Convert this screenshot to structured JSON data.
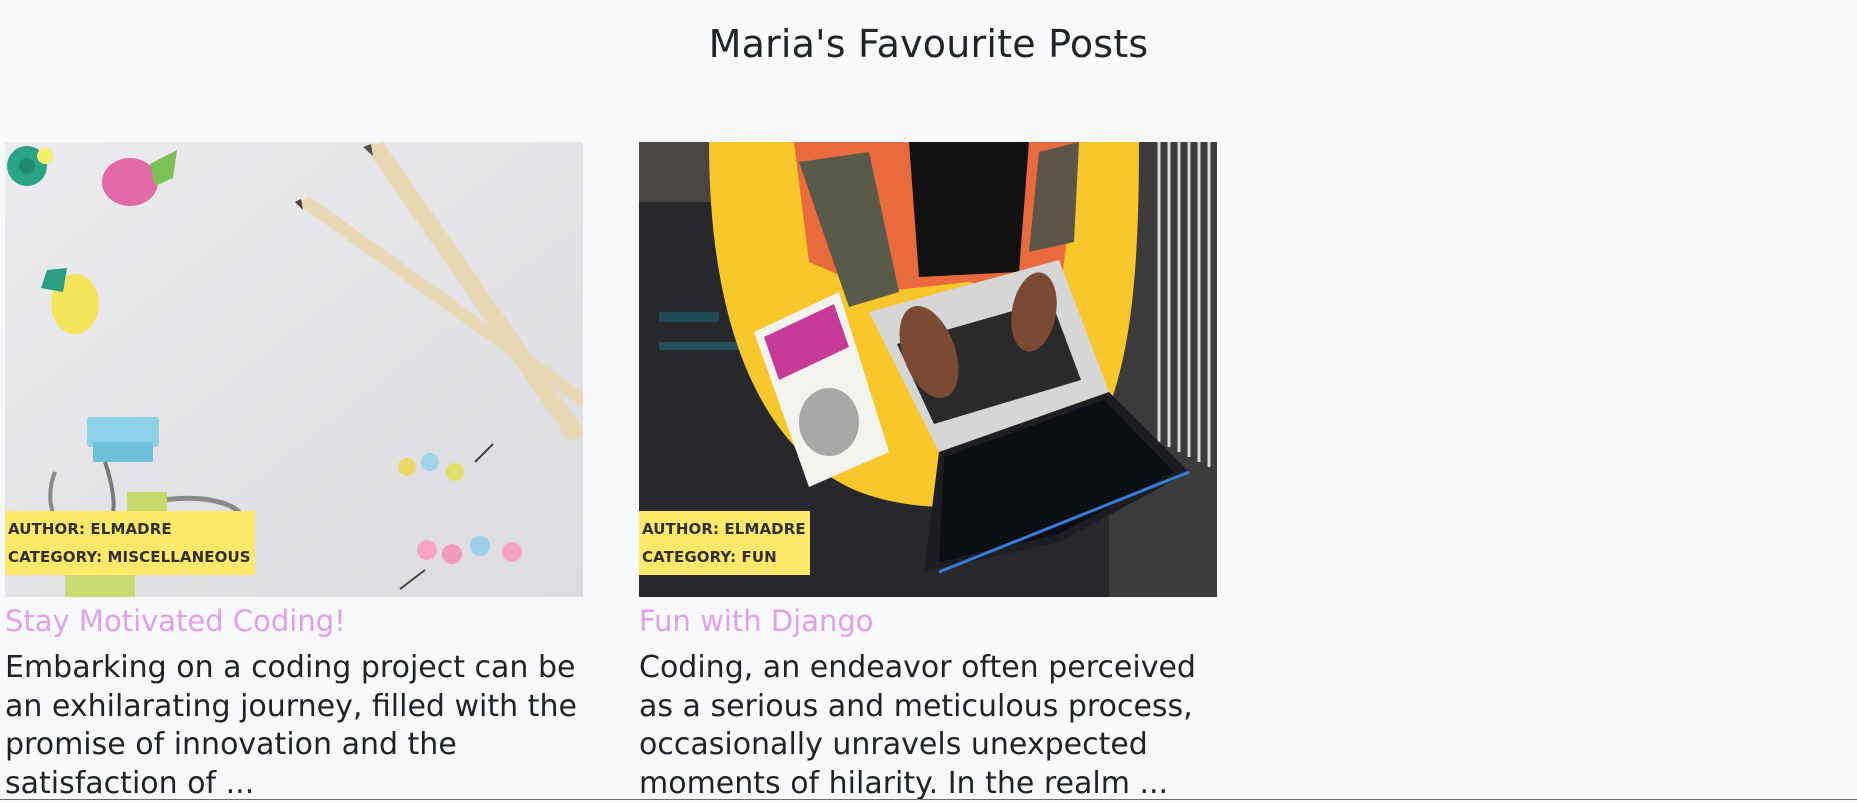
{
  "page": {
    "title": "Maria's Favourite Posts"
  },
  "posts": [
    {
      "title": "Stay Motivated Coding!",
      "author": "AUTHOR: ELMADRE",
      "category": "CATEGORY: MISCELLANEOUS",
      "excerpt": "Embarking on a coding project can be an exhilarating journey, filled with the promise of innovation and the satisfaction of ...",
      "image_alt": "Pencils, pushpins, binder clips and fruit erasers on a white desk"
    },
    {
      "title": "Fun with Django",
      "author": "AUTHOR: ELMADRE",
      "category": "CATEGORY: FUN",
      "excerpt": "Coding, an endeavor often perceived as a serious and meticulous process, occasionally unravels unexpected moments of hilarity. In the realm ...",
      "image_alt": "Person typing on a laptop in a yellow chair with a Python book"
    }
  ],
  "colors": {
    "background": "#f8f9fb",
    "title_link": "#e0a0ec",
    "badge": "#ffe86a",
    "text": "#212529"
  }
}
